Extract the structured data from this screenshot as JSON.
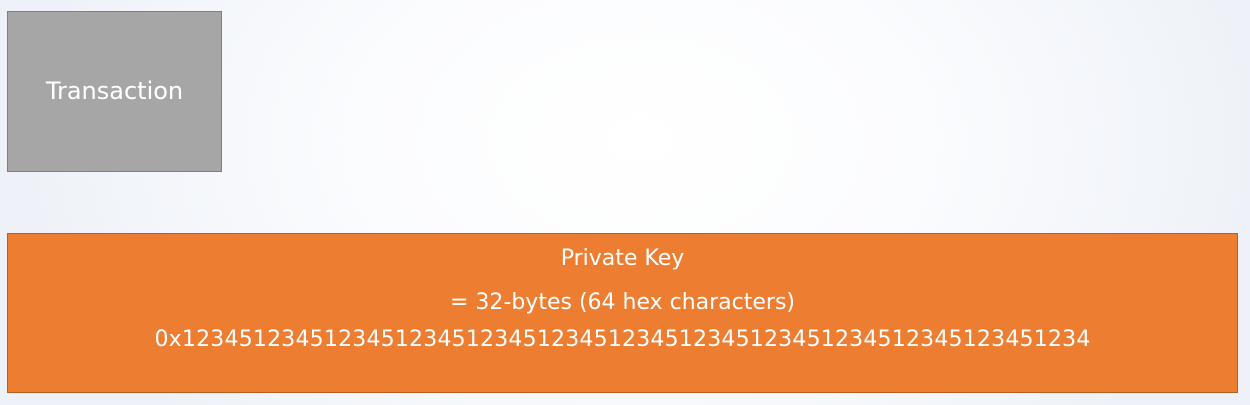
{
  "transaction": {
    "label": "Transaction"
  },
  "private_key": {
    "title": "Private Key",
    "size_description": "= 32-bytes (64 hex characters)",
    "example_value": "0x1234512345123451234512345123451234512345123451234512345123451234"
  },
  "colors": {
    "transaction_fill": "#a6a6a6",
    "private_key_fill": "#ed7d31",
    "text": "#ffffff"
  }
}
